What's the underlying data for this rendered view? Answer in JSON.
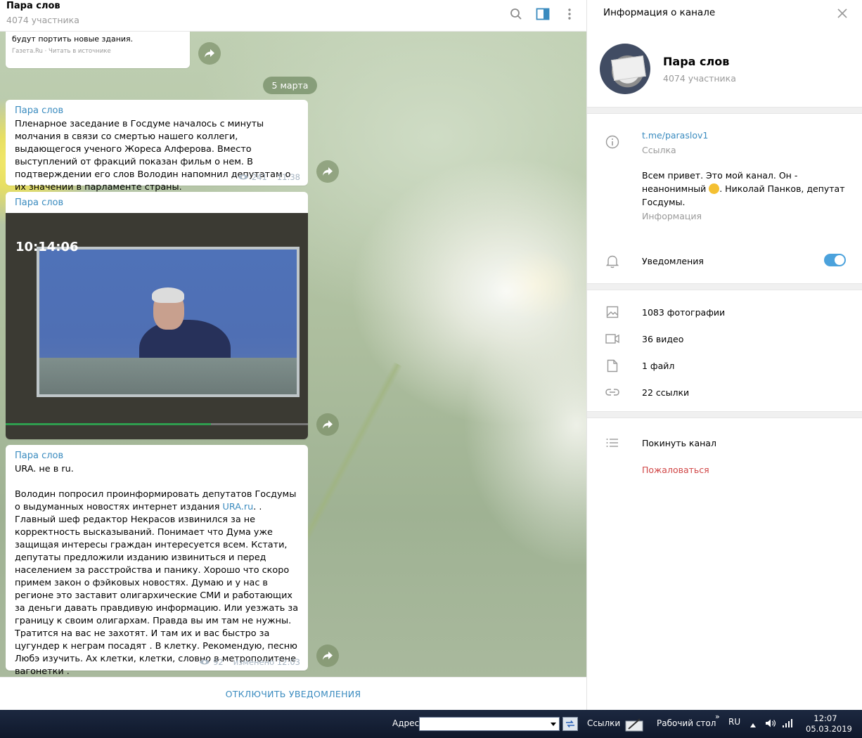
{
  "chat": {
    "title": "Пара слов",
    "subtitle": "4074 участника",
    "prev_message_tail": "будут портить новые здания.",
    "prev_source": "Газета.Ru · Читать в источнике",
    "date_pill": "5 марта",
    "messages": [
      {
        "author": "Пара слов",
        "text": "Пленарное заседание в Госдуме началось с минуты молчания в связи со  смертью  нашего коллеги, выдающегося ученого Жореса Алферова. Вместо выступлений от фракций показан фильм о нем. В подтверждении его слов Володин напомнил депутатам о их значении в парламенте страны.",
        "views": "241",
        "time": "11:38"
      },
      {
        "author": "Пара слов",
        "video_timestamp": "10:14:06",
        "video_progress_pct": 68
      },
      {
        "author": "Пара слов",
        "line1": "URA. не в ru.",
        "text_before_link": "Володин попросил проинформировать депутатов Госдумы о выдуманных новостях интернет  издания ",
        "link": "URA.ru",
        "text_after_link": ". . Главный шеф редактор Некрасов извинился за не корректность высказываний. Понимает что Дума уже защищая интересы граждан интересуется всем. Кстати, депутаты предложили изданию извиниться и перед населением за расстройства и панику. Хорошо что скоро примем закон о фэйковых новостях. Думаю и у нас в регионе это заставит олигархические СМИ и работающих за деньги давать правдивую информацию. Или уезжать за границу к своим олигархам. Правда вы им там не нужны. Тратится на вас не захотят. И там их и вас быстро за цугундер к неграм  посадят . В клетку. Рекомендую, песню Любэ изучить. Ах клетки, клетки, словно в метрополитене вагонетки .",
        "views": "92",
        "time": "изменено 12:03"
      }
    ],
    "bottom_action": "ОТКЛЮЧИТЬ УВЕДОМЛЕНИЯ"
  },
  "panel": {
    "title": "Информация о канале",
    "channel_name": "Пара слов",
    "channel_count": "4074 участника",
    "link": "t.me/paraslov1",
    "link_label": "Ссылка",
    "description_before_emoji": "Всем привет. Это мой канал. Он  - неанонимный ",
    "description_after_emoji": ". Николай Панков, депутат Госдумы.",
    "description_label": "Информация",
    "notifications_label": "Уведомления",
    "notifications_on": true,
    "media": [
      {
        "label": "1083 фотографии",
        "icon": "image-icon"
      },
      {
        "label": "36 видео",
        "icon": "video-icon"
      },
      {
        "label": "1 файл",
        "icon": "file-icon"
      },
      {
        "label": "22 ссылки",
        "icon": "link-icon"
      }
    ],
    "leave_label": "Покинуть канал",
    "report_label": "Пожаловаться"
  },
  "taskbar": {
    "address_label": "Адрес",
    "address_value": "",
    "links_label": "Ссылки",
    "desktop_label": "Рабочий стол",
    "lang": "RU",
    "time": "12:07",
    "date": "05.03.2019"
  },
  "colors": {
    "accent": "#3a8bbf",
    "danger": "#d04545",
    "toggle": "#4ba2dc"
  }
}
